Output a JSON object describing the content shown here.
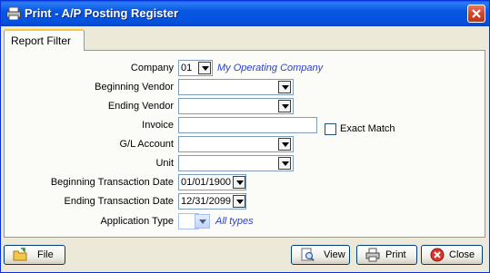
{
  "window": {
    "title": "Print - A/P Posting Register"
  },
  "tabs": [
    {
      "label": "Report Filter"
    }
  ],
  "form": {
    "company": {
      "label": "Company",
      "value": "01",
      "note": "My Operating Company"
    },
    "beginning_vendor": {
      "label": "Beginning Vendor",
      "value": ""
    },
    "ending_vendor": {
      "label": "Ending Vendor",
      "value": ""
    },
    "invoice": {
      "label": "Invoice",
      "value": ""
    },
    "exact_match": {
      "label": "Exact Match",
      "checked": false
    },
    "gl_account": {
      "label": "G/L Account",
      "value": ""
    },
    "unit": {
      "label": "Unit",
      "value": ""
    },
    "beginning_transaction_date": {
      "label": "Beginning Transaction Date",
      "value": "01/01/1900"
    },
    "ending_transaction_date": {
      "label": "Ending Transaction Date",
      "value": "12/31/2099"
    },
    "application_type": {
      "label": "Application Type",
      "value": "",
      "note": "All types"
    }
  },
  "buttons": {
    "file": "File",
    "view": "View",
    "print": "Print",
    "close": "Close"
  },
  "colors": {
    "titlebar": "#0758e3",
    "dialog": "#ece9d8",
    "note": "#2d3fc9",
    "tab_accent": "#ffc83c",
    "close_red": "#d2452b"
  },
  "icons": [
    "printer-icon",
    "close-icon",
    "folder-icon",
    "view-icon",
    "print-icon",
    "close-circle-icon",
    "chevron-down-icon"
  ]
}
